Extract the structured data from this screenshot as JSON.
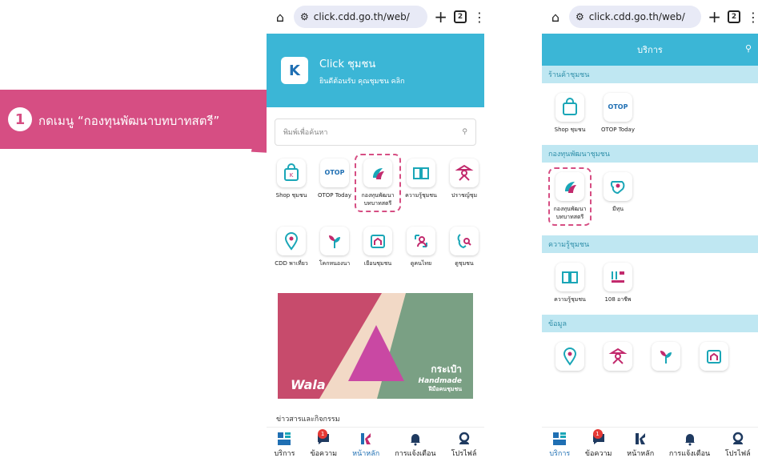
{
  "callout": {
    "number": "1",
    "text": "กดเมนู “กองทุนพัฒนาบทบาทสตรี”"
  },
  "browser": {
    "url": "click.cdd.go.th/web/",
    "tab_count": "2"
  },
  "hero": {
    "title": "Click ชุมชน",
    "subtitle": "ยินดีต้อนรับ  คุณชุมชน คลิก"
  },
  "search": {
    "placeholder": "พิมพ์เพื่อค้นหา"
  },
  "home_grid": [
    {
      "label": "Shop ชุมชน",
      "icon": "shop-bag-icon"
    },
    {
      "label": "OTOP Today",
      "icon": "otop-logo"
    },
    {
      "label": "กองทุนพัฒนา\nบทบาทสตรี",
      "icon": "women-fund-icon"
    },
    {
      "label": "ความรู้ชุมชน",
      "icon": "book-icon"
    },
    {
      "label": "ปราชญ์ชุม",
      "icon": "sage-icon"
    },
    {
      "label": "CDD พาเที่ยว",
      "icon": "location-pin-icon"
    },
    {
      "label": "โคกหนองนา",
      "icon": "sprout-icon"
    },
    {
      "label": "เยือนชุมชน",
      "icon": "home-visit-icon"
    },
    {
      "label": "ดูคนไทย",
      "icon": "person-card-icon"
    },
    {
      "label": "ดูชุมชน",
      "icon": "map-search-icon"
    }
  ],
  "banner": {
    "brand_line1": "กระเป๋า",
    "brand_line2": "Handmade",
    "brand_line3": "ฝีมือคนชุมชน",
    "wala": "Wala"
  },
  "news_title": "ข่าวสารและกิจกรรม",
  "bottom_nav": [
    {
      "label": "บริการ",
      "icon": "services-grid-icon"
    },
    {
      "label": "ข้อความ",
      "icon": "message-icon",
      "badge": "1"
    },
    {
      "label": "หน้าหลัก",
      "icon": "home-logo-icon"
    },
    {
      "label": "การแจ้งเตือน",
      "icon": "bell-icon"
    },
    {
      "label": "โปรไฟล์",
      "icon": "profile-icon"
    }
  ],
  "services": {
    "title": "บริการ",
    "sections": [
      {
        "title": "ร้านค้าชุมชน",
        "items": [
          {
            "label": "Shop ชุมชน"
          },
          {
            "label": "OTOP Today"
          }
        ]
      },
      {
        "title": "กองทุนพัฒนาชุมชน",
        "items": [
          {
            "label": "กองทุนพัฒนา\nบทบาทสตรี"
          },
          {
            "label": "มีทุน"
          }
        ]
      },
      {
        "title": "ความรู้ชุมชน",
        "items": [
          {
            "label": "ความรู้ชุมชน"
          },
          {
            "label": "108 อาชีพ"
          }
        ]
      },
      {
        "title": "ข้อมูล",
        "items": [
          {
            "label": ""
          },
          {
            "label": ""
          },
          {
            "label": ""
          },
          {
            "label": ""
          }
        ]
      }
    ]
  },
  "colors": {
    "brand_blue": "#3bb6d6",
    "accent_pink": "#d64e83",
    "teal_icon": "#1aa6b7",
    "magenta_icon": "#c22a6d"
  }
}
